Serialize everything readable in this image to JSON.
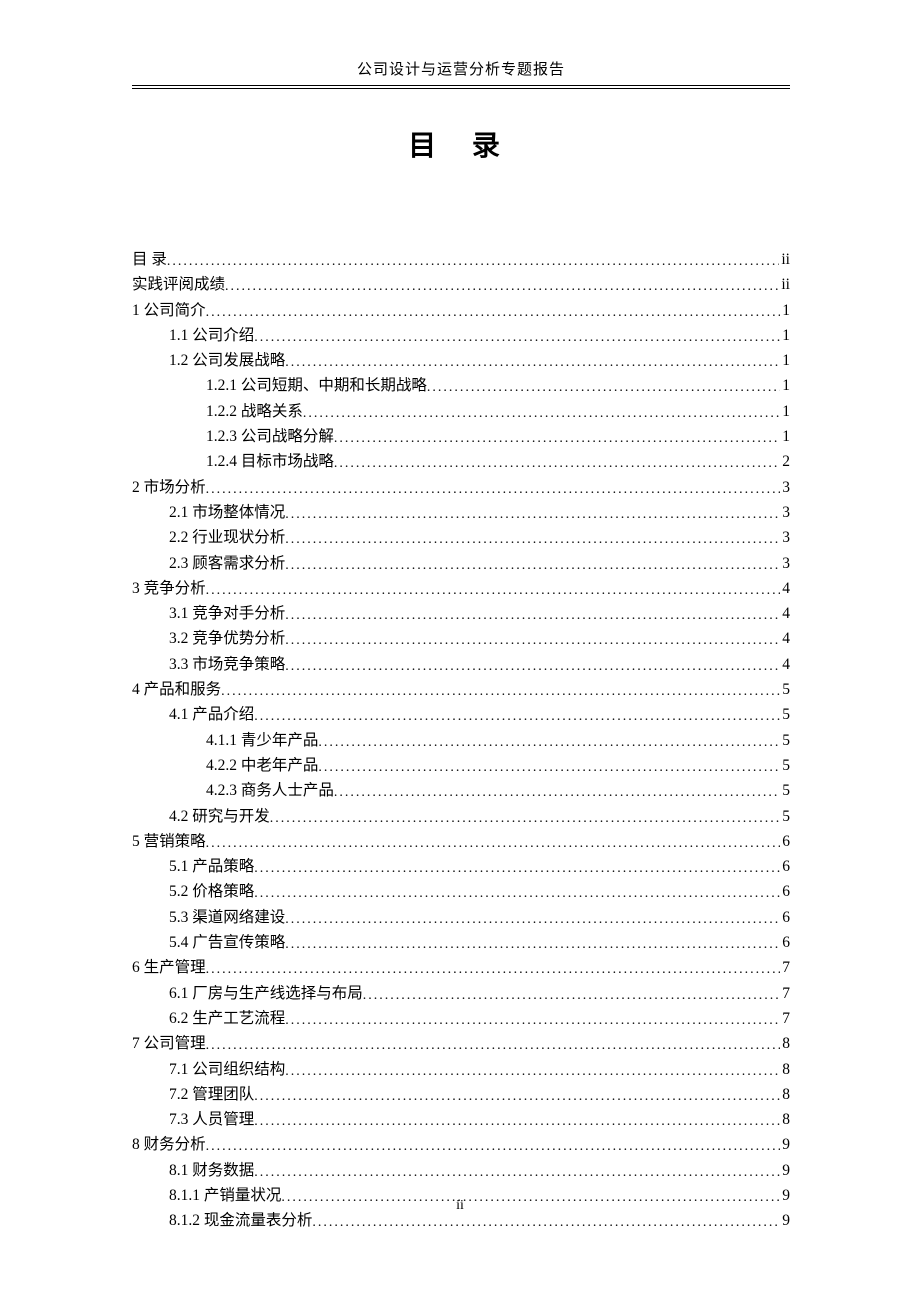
{
  "header": {
    "running_head": "公司设计与运营分析专题报告"
  },
  "toc": {
    "title": "目  录",
    "entries": [
      {
        "label": "目   录",
        "page": "ii",
        "level": 0
      },
      {
        "label": "实践评阅成绩",
        "page": "ii",
        "level": 0
      },
      {
        "label": "1 公司简介",
        "page": "1",
        "level": 0
      },
      {
        "label": "1.1 公司介绍",
        "page": "1",
        "level": 1
      },
      {
        "label": "1.2 公司发展战略",
        "page": "1",
        "level": 1
      },
      {
        "label": "1.2.1 公司短期、中期和长期战略",
        "page": "1",
        "level": 2
      },
      {
        "label": "1.2.2 战略关系",
        "page": "1",
        "level": 2
      },
      {
        "label": "1.2.3 公司战略分解",
        "page": "1",
        "level": 2
      },
      {
        "label": "1.2.4 目标市场战略",
        "page": "2",
        "level": 2
      },
      {
        "label": "2 市场分析",
        "page": "3",
        "level": 0
      },
      {
        "label": "2.1  市场整体情况",
        "page": "3",
        "level": 1
      },
      {
        "label": "2.2  行业现状分析",
        "page": "3",
        "level": 1
      },
      {
        "label": "2.3  顾客需求分析",
        "page": "3",
        "level": 1
      },
      {
        "label": "3 竞争分析",
        "page": "4",
        "level": 0
      },
      {
        "label": "3.1  竞争对手分析",
        "page": "4",
        "level": 1
      },
      {
        "label": "3.2 竞争优势分析",
        "page": "4",
        "level": 1
      },
      {
        "label": "3.3  市场竞争策略",
        "page": "4",
        "level": 1
      },
      {
        "label": "4 产品和服务",
        "page": "5",
        "level": 0
      },
      {
        "label": "4.1  产品介绍",
        "page": "5",
        "level": 1
      },
      {
        "label": "4.1.1  青少年产品",
        "page": "5",
        "level": 2
      },
      {
        "label": "4.2.2  中老年产品",
        "page": "5",
        "level": 2
      },
      {
        "label": "4.2.3  商务人士产品",
        "page": "5",
        "level": 2
      },
      {
        "label": "4.2  研究与开发",
        "page": "5",
        "level": 1
      },
      {
        "label": "5 营销策略",
        "page": "6",
        "level": 0
      },
      {
        "label": "5.1  产品策略",
        "page": "6",
        "level": 1
      },
      {
        "label": "5.2  价格策略",
        "page": "6",
        "level": 1
      },
      {
        "label": "5.3  渠道网络建设",
        "page": "6",
        "level": 1
      },
      {
        "label": "5.4 广告宣传策略",
        "page": "6",
        "level": 1
      },
      {
        "label": "6 生产管理",
        "page": "7",
        "level": 0
      },
      {
        "label": "6.1  厂房与生产线选择与布局",
        "page": "7",
        "level": 1
      },
      {
        "label": "6.2  生产工艺流程",
        "page": "7",
        "level": 1
      },
      {
        "label": "7 公司管理",
        "page": "8",
        "level": 0
      },
      {
        "label": "7.1  公司组织结构",
        "page": "8",
        "level": 1
      },
      {
        "label": "7.2  管理团队",
        "page": "8",
        "level": 1
      },
      {
        "label": "7.3 人员管理",
        "page": "8",
        "level": 1
      },
      {
        "label": "8 财务分析",
        "page": "9",
        "level": 0
      },
      {
        "label": "8.1  财务数据",
        "page": "9",
        "level": 1
      },
      {
        "label": "8.1.1  产销量状况",
        "page": "9",
        "level": 1
      },
      {
        "label": "8.1.2  现金流量表分析",
        "page": "9",
        "level": 1
      }
    ]
  },
  "footer": {
    "page_number": "ii"
  }
}
